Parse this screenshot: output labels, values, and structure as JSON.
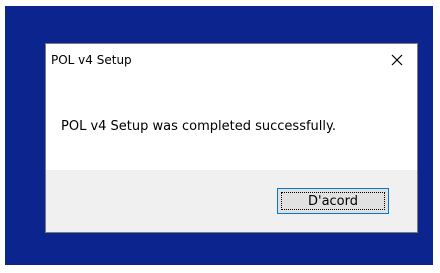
{
  "dialog": {
    "title": "POL v4 Setup",
    "message": "POL v4 Setup was completed successfully.",
    "ok_label": "D'acord",
    "close_icon": "close-icon"
  },
  "colors": {
    "desktop_background": "#0b248e",
    "dialog_background": "#ffffff",
    "footer_background": "#f0f0f0",
    "button_face": "#e1e1e1",
    "button_focus_border": "#0078d7"
  }
}
